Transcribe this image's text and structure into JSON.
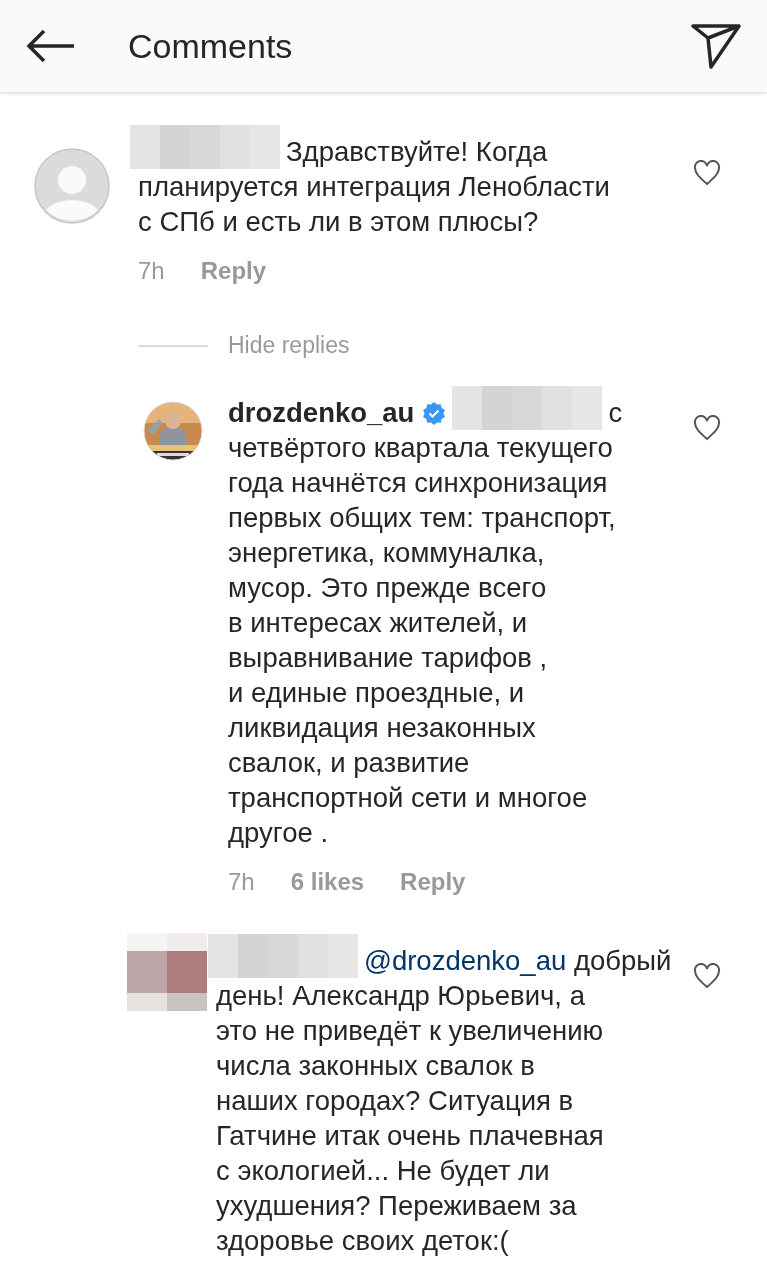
{
  "header": {
    "title": "Comments"
  },
  "comments": [
    {
      "avatar": {
        "kind": "placeholder"
      },
      "name_redacted": true,
      "lines": [
        "Здравствуйте! Когда",
        "планируется интеграция Ленобласти",
        "с СПб и есть ли в этом плюсы?"
      ],
      "time": "7h",
      "reply": "Reply",
      "liked": false,
      "replies_toggle": "Hide replies",
      "replies": [
        {
          "username": "drozdenko_au",
          "verified": true,
          "name_redacted": true,
          "lines": [
            "с",
            "четвёртого квартала текущего",
            "года начнётся синхронизация",
            "первых общих тем: транспорт,",
            "энергетика, коммуналка,",
            "мусор. Это прежде всего",
            "в интересах жителей, и",
            "выравнивание тарифов ,",
            "и единые проездные, и",
            "ликвидация незаконных",
            "свалок, и развитие",
            "транспортной сети и многое",
            "другое ."
          ],
          "time": "7h",
          "likes": "6 likes",
          "reply": "Reply",
          "liked": false
        },
        {
          "avatar": {
            "kind": "pixelated"
          },
          "name_redacted": true,
          "mention": "@drozdenko_au",
          "lines": [
            "добрый",
            "день! Александр Юрьевич, а",
            "это не приведёт к увеличению",
            "числа законных свалок в",
            "наших городах? Ситуация в",
            "Гатчине итак очень плачевная",
            "с экологией... Не будет ли",
            "ухудшения? Переживаем за",
            "здоровье своих деток:("
          ],
          "liked": false
        }
      ]
    }
  ]
}
